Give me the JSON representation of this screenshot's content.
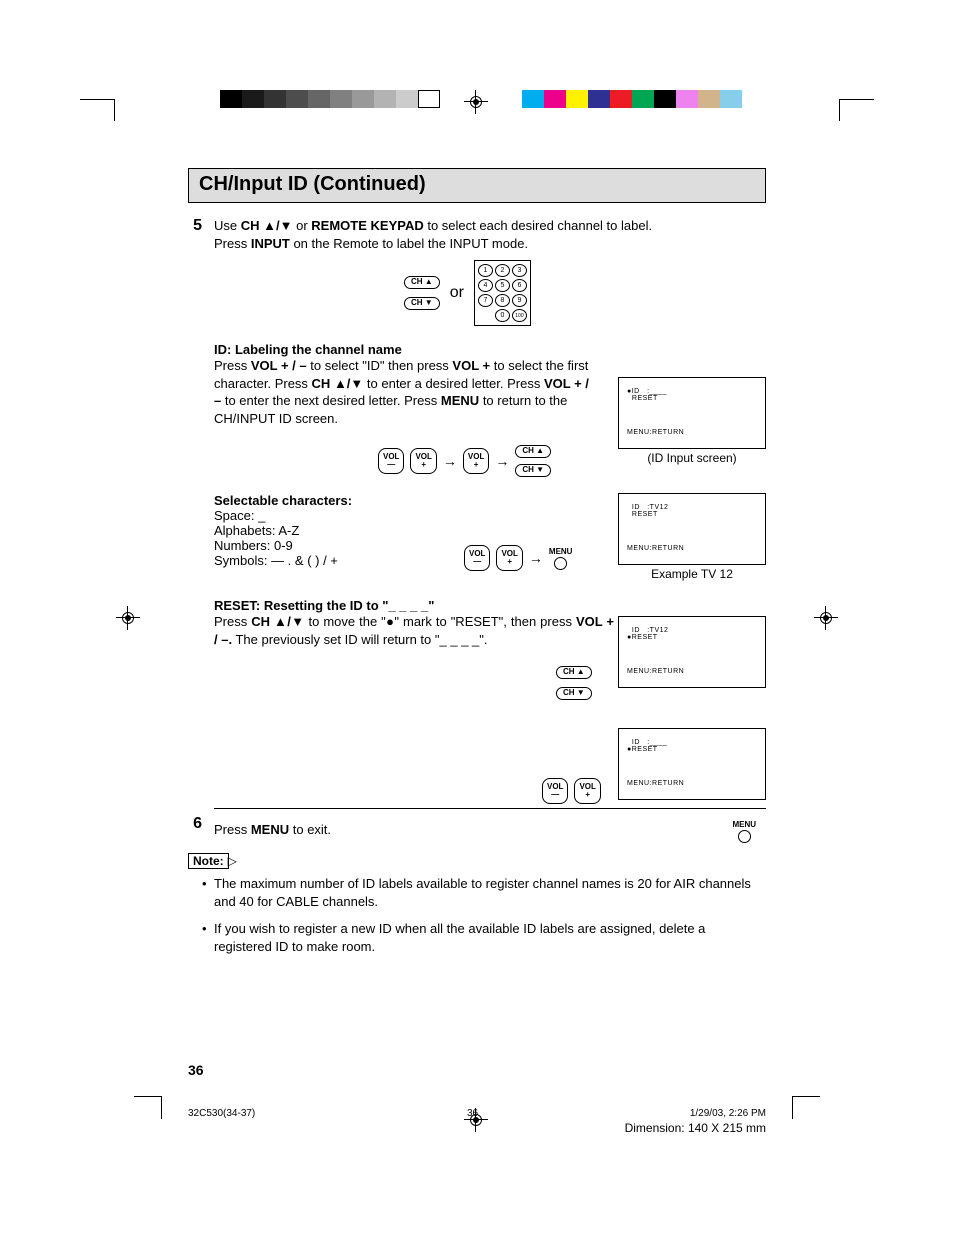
{
  "header": {
    "title": "CH/Input ID (Continued)"
  },
  "step5": {
    "num": "5",
    "line1a": "Use ",
    "line1b": "CH ",
    "line1c": " or ",
    "line1d": "REMOTE KEYPAD",
    "line1e": " to select each desired channel to label.",
    "line2a": "Press ",
    "line2b": "INPUT",
    "line2c": " on the Remote to label the INPUT mode.",
    "or": "or",
    "keypad": [
      "1",
      "2",
      "3",
      "4",
      "5",
      "6",
      "7",
      "8",
      "9",
      "",
      "0",
      "100"
    ]
  },
  "idLabel": {
    "head": "ID: Labeling the channel name",
    "p1a": "Press ",
    "p1b": "VOL ",
    "p1c": " to select \"ID\" then press  ",
    "p1d": "VOL ",
    "p1e": " to select the first character. Press ",
    "p1f": "CH ",
    "p1g": " to enter a desired letter. Press ",
    "p1h": "VOL ",
    "p1i": " to enter the next desired letter. Press ",
    "p1j": "MENU",
    "p1k": " to return to the CH/INPUT ID screen."
  },
  "selectable": {
    "head": "Selectable characters:",
    "l1": "Space: _",
    "l2": "Alphabets: A-Z",
    "l3": "Numbers: 0-9",
    "l4": "Symbols: —  .  &  (  )  /  +"
  },
  "reset": {
    "head": "RESET: Resetting the ID to \"_ _ _ _\"",
    "p1a": "Press ",
    "p1b": "CH ",
    "p1c": " to move the \"●\" mark to \"RESET\", then press ",
    "p1d": "VOL ",
    "p1e": " The previously set ID will return to \"_ _ _ _\"."
  },
  "step6": {
    "num": "6",
    "p1a": "Press ",
    "p1b": "MENU",
    "p1c": " to exit."
  },
  "note": {
    "label": "Note:",
    "items": [
      "The maximum number of ID labels available to register channel names is 20 for AIR channels and 40 for CABLE channels.",
      "If you wish to register a new ID when all the available ID labels are assigned, delete a registered ID to make room."
    ]
  },
  "screens": {
    "s1l1": "●ID   :____",
    "s1l2": "  RESET",
    "menu_return": "MENU:RETURN",
    "cap1": "(ID Input screen)",
    "s2l1": "  ID   :TV12",
    "s2l2": "  RESET",
    "cap2": "Example TV 12",
    "s3l1": "  ID   :TV12",
    "s3l2": "●RESET",
    "s4l1": "  ID   :____",
    "s4l2": "●RESET"
  },
  "buttons": {
    "ch_up": "CH ▲",
    "ch_dn": "CH ▼",
    "vol_m": "VOL\n—",
    "vol_p": "VOL\n+",
    "menu": "MENU"
  },
  "symbols": {
    "plus": "+",
    "minus": "–",
    "plusminus": "+ / –",
    "updown": "▲/▼",
    "updown_solid": "▲/▼",
    "dot": "."
  },
  "footer": {
    "file": "32C530(34-37)",
    "pg": "36",
    "dt": "1/29/03, 2:26 PM",
    "dim": "Dimension: 140  X 215 mm",
    "pagenum": "36"
  }
}
